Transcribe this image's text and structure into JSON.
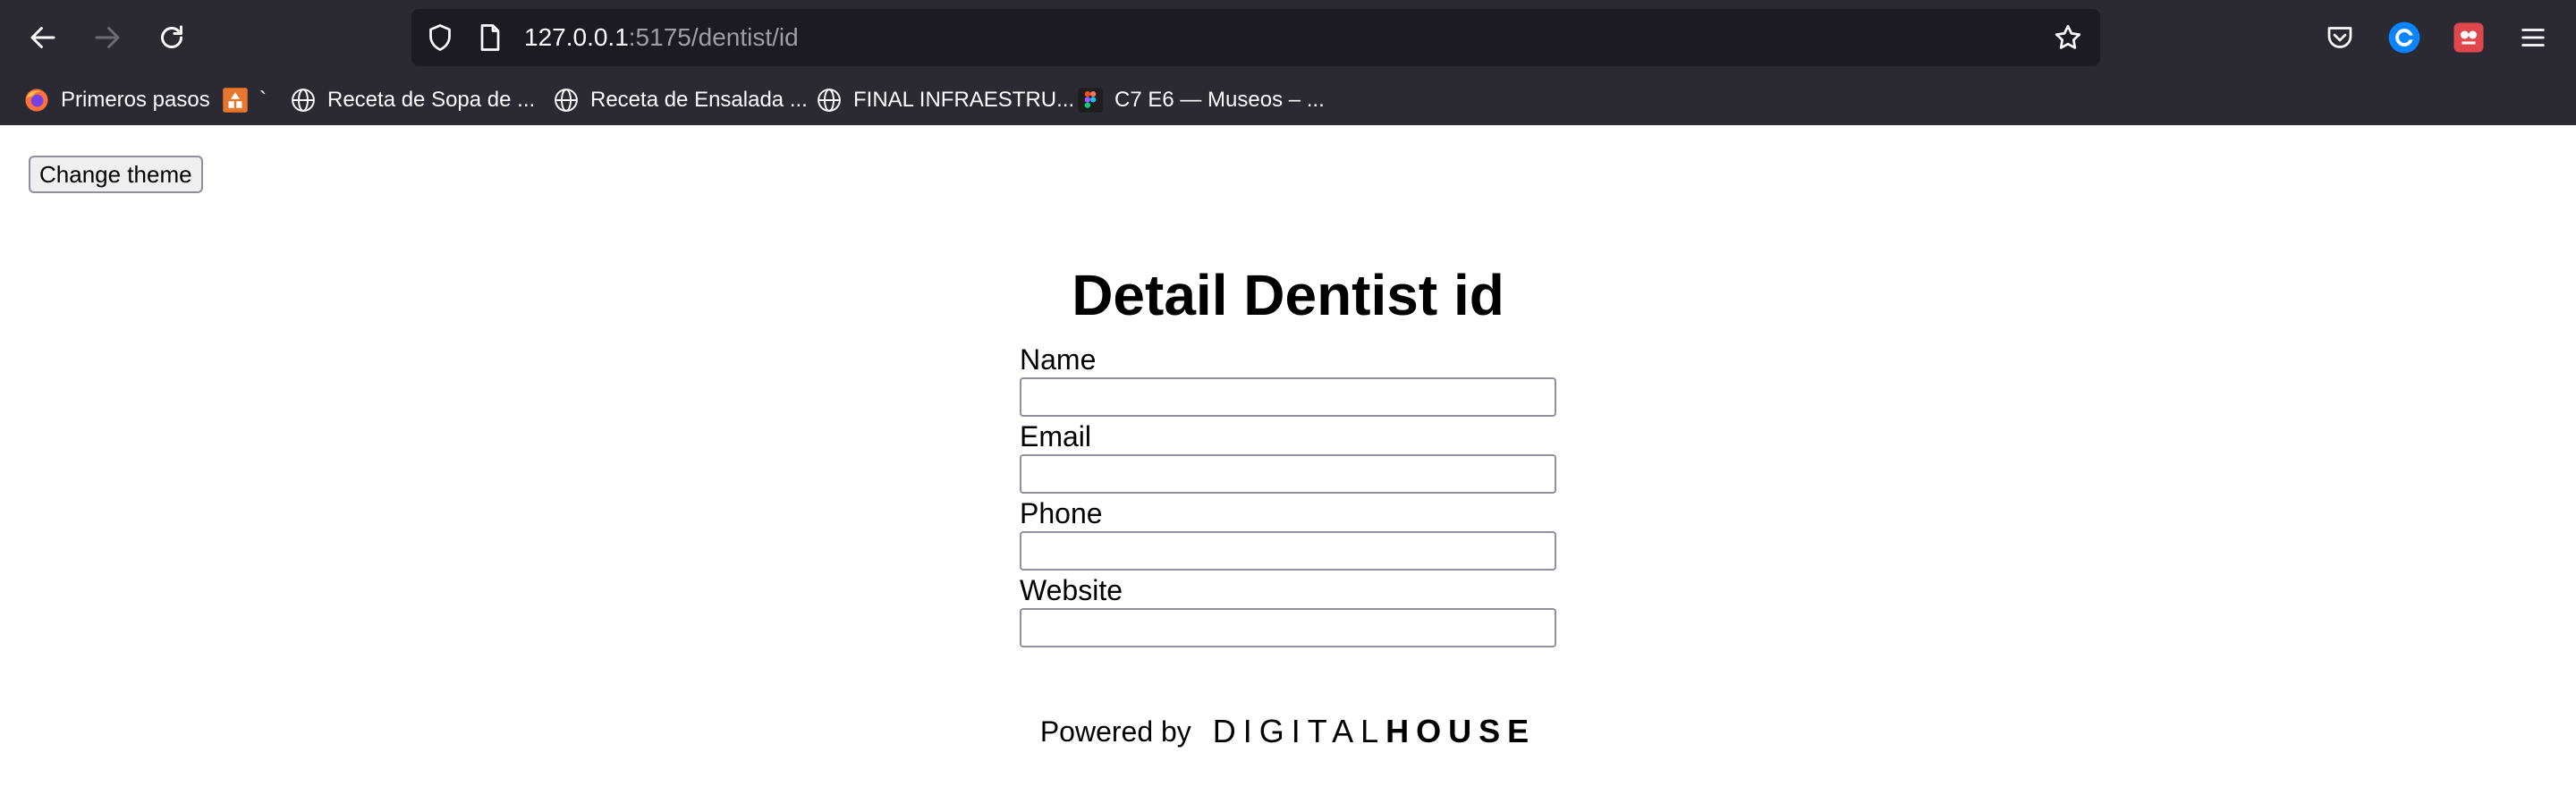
{
  "browser": {
    "url_host": "127.0.0.1",
    "url_path": ":5175/dentist/id",
    "bookmarks": [
      {
        "label": "Primeros pasos",
        "icon": "firefox-icon"
      },
      {
        "label": "`",
        "icon": "orange-app-icon"
      },
      {
        "label": "Receta de Sopa de ...",
        "icon": "globe-icon"
      },
      {
        "label": "Receta de Ensalada ...",
        "icon": "globe-icon"
      },
      {
        "label": "FINAL INFRAESTRU...",
        "icon": "globe-icon"
      },
      {
        "label": "C7 E6 — Museos – ...",
        "icon": "figma-icon"
      }
    ]
  },
  "page": {
    "theme_button": "Change theme",
    "title": "Detail Dentist id",
    "fields": [
      {
        "label": "Name",
        "value": ""
      },
      {
        "label": "Email",
        "value": ""
      },
      {
        "label": "Phone",
        "value": ""
      },
      {
        "label": "Website",
        "value": ""
      }
    ],
    "footer": {
      "powered_by": "Powered by",
      "brand_light": "DIGITAL",
      "brand_bold": "HOUSE"
    }
  },
  "colors": {
    "chrome_bg": "#2b2a33",
    "urlbar_bg": "#1c1b22",
    "accent_blue": "#0a84ff"
  }
}
